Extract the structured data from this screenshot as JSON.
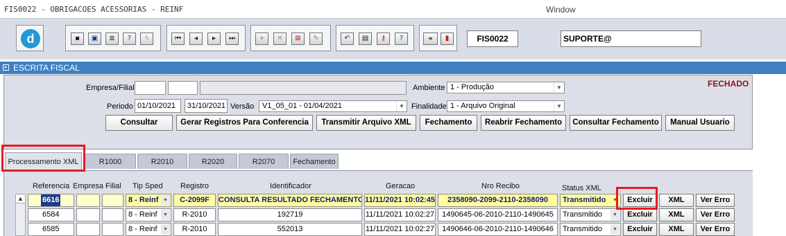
{
  "window": {
    "title": "FIS0022 - OBRIGACOES ACESSORIAS - REINF",
    "menu_label": "Window"
  },
  "toolbar": {
    "groups": [
      [
        "save-icon",
        "window-icon",
        "print-icon",
        "search-help-icon",
        "lightning-icon"
      ],
      [
        "first-record-icon",
        "prev-record-icon",
        "next-record-icon",
        "last-record-icon"
      ],
      [
        "insert-record-icon",
        "delete-record-icon",
        "query-icon",
        "clear-icon"
      ],
      [
        "undo-icon",
        "clipboard-icon",
        "key-icon",
        "help-icon"
      ],
      [
        "menu-icon",
        "exit-icon"
      ]
    ],
    "program_code": "FIS0022",
    "user": "SUPORTE@"
  },
  "section": {
    "title": "ESCRITA FISCAL"
  },
  "form": {
    "status": "FECHADO",
    "empresa_label": "Empresa/Filial",
    "empresa": "",
    "filial": "",
    "empresa_nome": "",
    "ambiente_label": "Ambiente",
    "ambiente": "1 - Produção",
    "periodo_label": "Periodo",
    "periodo_ini": "01/10/2021",
    "periodo_fim": "31/10/2021",
    "versao_label": "Versão",
    "versao": "V1_05_01 - 01/04/2021",
    "finalidade_label": "Finalidade",
    "finalidade": "1 - Arquivo Original"
  },
  "actions": [
    "Consultar",
    "Gerar Registros Para Conferencia",
    "Transmitir Arquivo XML",
    "Fechamento",
    "Reabrir Fechamento",
    "Consultar Fechamento",
    "Manual Usuario"
  ],
  "tabs": [
    "Processamento XML",
    "R1000",
    "R2010",
    "R2020",
    "R2070",
    "Fechamento"
  ],
  "grid": {
    "headers": [
      "Referencia",
      "Empresa",
      "Filial",
      "Tip Sped",
      "Registro",
      "Identificador",
      "Geracao",
      "Nro Recibo",
      "Status XML"
    ],
    "rows": [
      {
        "ref": "6616",
        "empresa": "",
        "filial": "",
        "tip": "8 - Reinf",
        "registro": "C-2099F",
        "ident": "CONSULTA RESULTADO FECHAMENTO",
        "geracao": "11/11/2021 10:02:45",
        "recibo": "2358090-2099-2110-2358090",
        "status": "Transmitido",
        "excluir": "Excluir",
        "xml": "XML",
        "erro": "Ver Erro"
      },
      {
        "ref": "6584",
        "empresa": "",
        "filial": "",
        "tip": "8 - Reinf",
        "registro": "R-2010",
        "ident": "192719",
        "geracao": "11/11/2021 10:02:27",
        "recibo": "1490645-06-2010-2110-1490645",
        "status": "Transmitido",
        "excluir": "Excluir",
        "xml": "XML",
        "erro": "Ver Erro"
      },
      {
        "ref": "6585",
        "empresa": "",
        "filial": "",
        "tip": "8 - Reinf",
        "registro": "R-2010",
        "ident": "552013",
        "geracao": "11/11/2021 10:02:27",
        "recibo": "1490646-06-2010-2110-1490646",
        "status": "Transmitido",
        "excluir": "Excluir",
        "xml": "XML",
        "erro": "Ver Erro"
      }
    ]
  }
}
